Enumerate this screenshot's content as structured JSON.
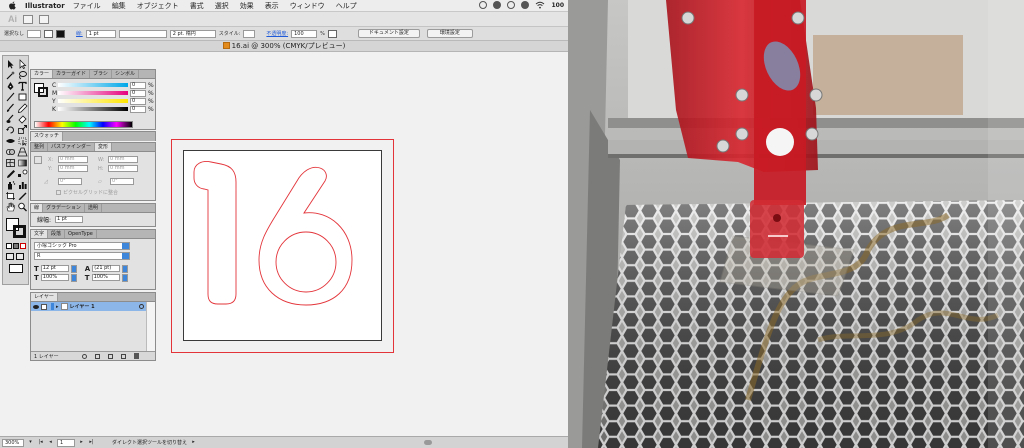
{
  "menubar": {
    "app_name": "Illustrator",
    "items": [
      "ファイル",
      "編集",
      "オブジェクト",
      "書式",
      "選択",
      "効果",
      "表示",
      "ウィンドウ",
      "ヘルプ"
    ],
    "battery": "100"
  },
  "appbar": {
    "logo": "Ai"
  },
  "controlbar": {
    "selection": "選択なし",
    "stroke_label": "線:",
    "stroke_weight": "1 pt",
    "brush": "2 pt. 楕円",
    "style_label": "スタイル:",
    "opacity_label": "不透明度:",
    "opacity_value": "100",
    "percent": "%",
    "doc_setup": "ドキュメント設定",
    "preferences": "環境設定"
  },
  "document": {
    "title": "16.ai @ 300% (CMYK/プレビュー)"
  },
  "color_panel": {
    "tabs": [
      "カラー",
      "カラーガイド",
      "ブラシ",
      "シンボル"
    ],
    "channels": [
      {
        "label": "C",
        "value": "0",
        "unit": "%"
      },
      {
        "label": "M",
        "value": "0",
        "unit": "%"
      },
      {
        "label": "Y",
        "value": "0",
        "unit": "%"
      },
      {
        "label": "K",
        "value": "0",
        "unit": "%"
      }
    ]
  },
  "swatch_panel": {
    "title": "スウォッチ"
  },
  "transform_panel": {
    "tabs": [
      "整列",
      "パスファインダー",
      "変形"
    ],
    "x_label": "X:",
    "x_value": "0 mm",
    "w_label": "W:",
    "w_value": "0 mm",
    "y_label": "Y:",
    "y_value": "0 mm",
    "h_label": "H:",
    "h_value": "0 mm",
    "rotate_value": "0°",
    "shear_value": "0°",
    "pixel_grid": "ピクセルグリッドに整合"
  },
  "stroke_panel": {
    "tabs": [
      "線",
      "グラデーション",
      "透明"
    ],
    "weight_label": "線幅:",
    "weight_value": "1 pt"
  },
  "character_panel": {
    "tabs": [
      "文字",
      "段落",
      "OpenType"
    ],
    "font": "小塚ゴシック Pro",
    "style": "R",
    "size": "12 pt",
    "leading": "(21 pt)",
    "hscale": "100%",
    "vscale": "100%"
  },
  "layers_panel": {
    "title": "レイヤー",
    "layer_name": "レイヤー 1",
    "footer": "1 レイヤー"
  },
  "statusbar": {
    "zoom": "300%",
    "page": "1",
    "tool_hint": "ダイレクト選択ツールを切り替え"
  },
  "artwork": {
    "glyphs": "16",
    "stroke_color": "#e3343a"
  },
  "colors": {
    "accent_blue": "#3e86d9",
    "artboard_red": "#e3343a",
    "laser_red": "#c81a24"
  }
}
